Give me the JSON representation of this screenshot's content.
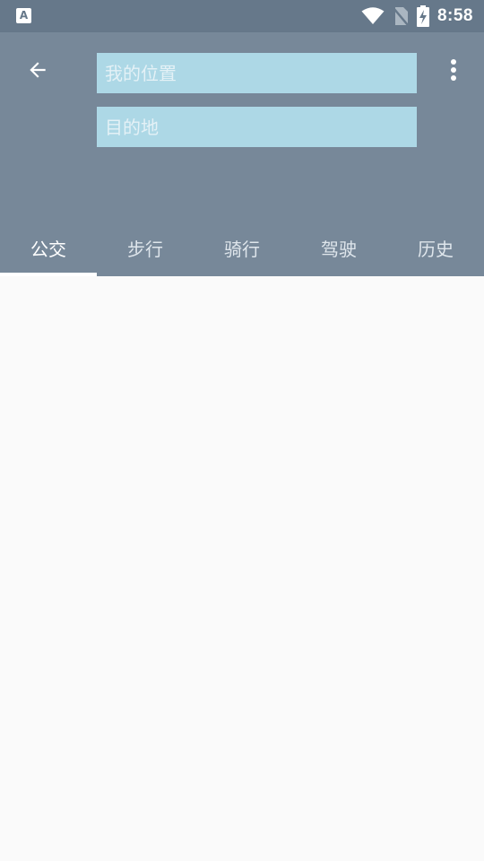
{
  "status_bar": {
    "app_icon": "A",
    "time": "8:58",
    "icons": [
      "wifi-icon",
      "no-sim-icon",
      "battery-charging-icon"
    ]
  },
  "toolbar": {
    "back_icon": "arrow-left-icon",
    "menu_icon": "more-vertical-icon",
    "origin_placeholder": "我的位置",
    "origin_value": "",
    "destination_placeholder": "目的地",
    "destination_value": ""
  },
  "tabs": [
    {
      "label": "公交",
      "active": true
    },
    {
      "label": "步行",
      "active": false
    },
    {
      "label": "骑行",
      "active": false
    },
    {
      "label": "驾驶",
      "active": false
    },
    {
      "label": "历史",
      "active": false
    }
  ],
  "colors": {
    "status_bar": "#66788a",
    "toolbar": "#778899",
    "input_bg": "#add8e6",
    "content_bg": "#fafafa"
  }
}
